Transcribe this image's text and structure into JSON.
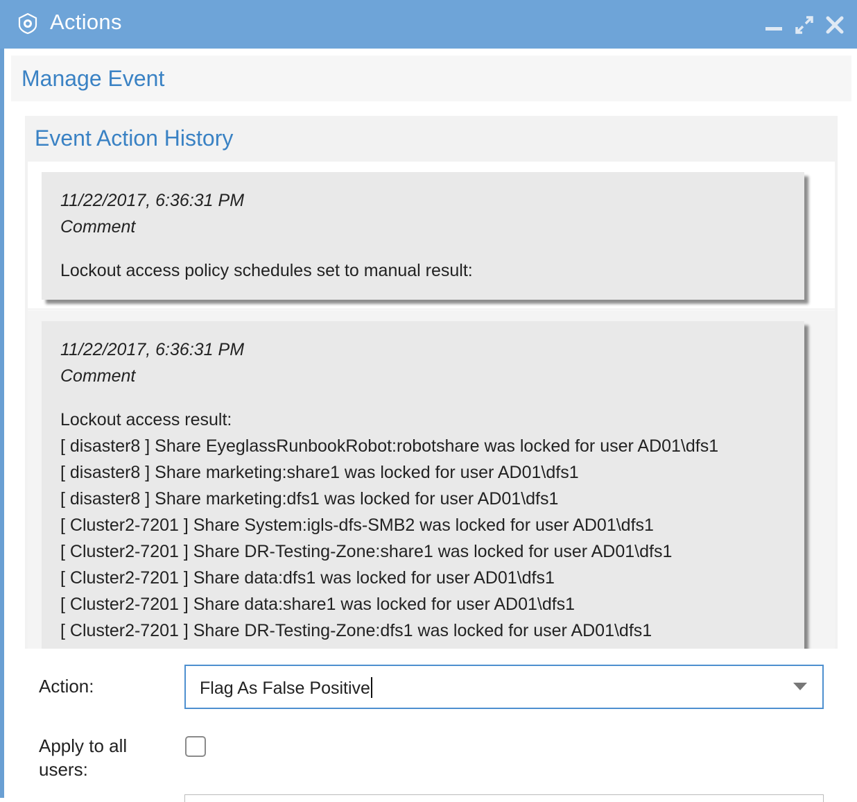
{
  "window": {
    "title": "Actions",
    "controls": [
      "minimize-icon",
      "expand-icon",
      "close-icon"
    ],
    "title_bar_color": "#6ea4d8"
  },
  "manage_event": {
    "heading": "Manage Event"
  },
  "history": {
    "heading": "Event Action History",
    "entries": [
      {
        "timestamp": "11/22/2017, 6:36:31 PM",
        "type": "Comment",
        "body": "Lockout access policy schedules set to manual result:"
      },
      {
        "timestamp": "11/22/2017, 6:36:31 PM",
        "type": "Comment",
        "body": "Lockout access result:\n[ disaster8 ] Share EyeglassRunbookRobot:robotshare was locked for user AD01\\dfs1\n[ disaster8 ] Share marketing:share1 was locked for user AD01\\dfs1\n[ disaster8 ] Share marketing:dfs1 was locked for user AD01\\dfs1\n[ Cluster2-7201 ] Share System:igls-dfs-SMB2 was locked for user AD01\\dfs1\n[ Cluster2-7201 ] Share DR-Testing-Zone:share1 was locked for user AD01\\dfs1\n[ Cluster2-7201 ] Share data:dfs1 was locked for user AD01\\dfs1\n[ Cluster2-7201 ] Share data:share1 was locked for user AD01\\dfs1\n[ Cluster2-7201 ] Share DR-Testing-Zone:dfs1 was locked for user AD01\\dfs1"
      }
    ]
  },
  "form": {
    "action_label": "Action:",
    "action_value": "Flag As False Positive",
    "apply_all_label": "Apply to all\nusers:",
    "apply_all_checked": false
  },
  "colors": {
    "accent": "#3a82c4",
    "select_border": "#4d8fcf"
  }
}
